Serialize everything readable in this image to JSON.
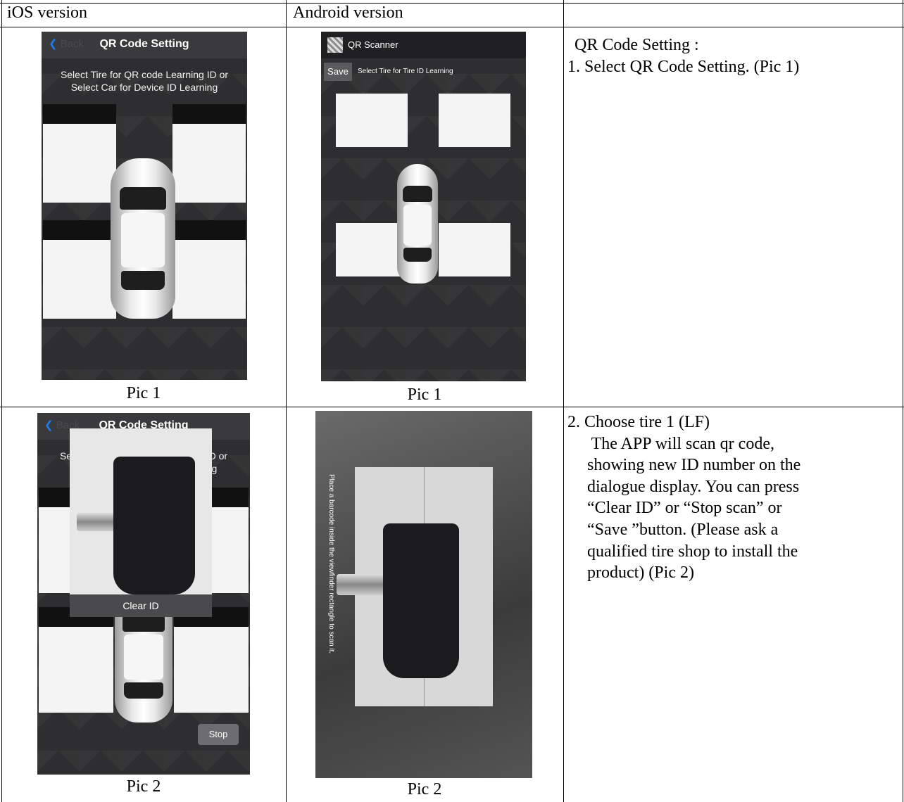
{
  "table": {
    "headers": [
      "iOS version",
      "Android version",
      ""
    ],
    "rows": [
      {
        "ios_caption": "Pic 1",
        "android_caption": "Pic 1",
        "description": {
          "heading": "QR Code Setting :",
          "step": "1. Select QR Code Setting. (Pic 1)"
        }
      },
      {
        "ios_caption": "Pic 2",
        "android_caption": "Pic 2",
        "description": {
          "heading": "2. Choose tire 1 (LF)",
          "lines": [
            " The APP will scan qr code,",
            "showing new ID number on the",
            "dialogue display. You can press",
            "“Clear ID” or “Stop scan” or",
            "“Save ”button. (Please ask a",
            "qualified tire shop to install the",
            "product) (Pic 2)"
          ]
        }
      }
    ]
  },
  "ios_screen_1": {
    "back_label": "Back",
    "title": "QR Code Setting",
    "message_line1": "Select Tire for QR code Learning ID or",
    "message_line2": "Select Car for Device ID Learning"
  },
  "android_screen_1": {
    "app_title": "QR Scanner",
    "save_label": "Save",
    "message": "Select Tire for Tire ID Learning"
  },
  "ios_screen_2": {
    "back_label": "Back",
    "title": "QR Code Setting",
    "message_line1": "Select Tire for QR code Learning ID or",
    "message_line2": "Select Car for Device ID Learning",
    "popup_button": "Clear ID",
    "stop_button": "Stop"
  },
  "android_screen_2": {
    "scan_tip": "Place a barcode inside the viewfinder rectangle to scan it."
  },
  "colors": {
    "ios_link_blue": "#1e7ae6",
    "screen_dark": "#2e2e30",
    "slot_white": "#f4f4f4"
  }
}
